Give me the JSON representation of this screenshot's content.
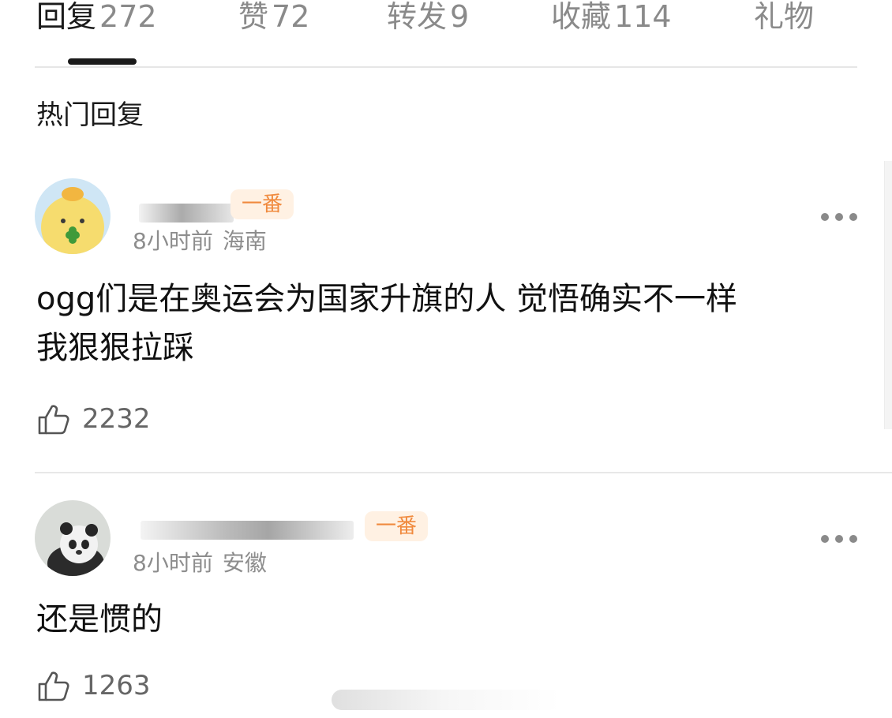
{
  "tabs": [
    {
      "label": "回复",
      "count": "272"
    },
    {
      "label": "赞",
      "count": "72"
    },
    {
      "label": "转发",
      "count": "9"
    },
    {
      "label": "收藏",
      "count": "114"
    },
    {
      "label": "礼物",
      "count": ""
    }
  ],
  "section_title": "热门回复",
  "comments": [
    {
      "badge": "一番",
      "time": "8小时前",
      "location": "海南",
      "text_line1": "ogg们是在奥运会为国家升旗的人 觉悟确实不一样",
      "text_line2": "我狠狠拉踩",
      "likes": "2232"
    },
    {
      "badge": "一番",
      "time": "8小时前",
      "location": "安徽",
      "text_line1": "还是惯的",
      "likes": "1263"
    }
  ],
  "colors": {
    "badge_text": "#f08a3e",
    "badge_bg": "#fff1e3",
    "active_tab": "#1a1a1a",
    "muted": "#8a8a8a"
  },
  "icons": [
    "thumbs-up-icon",
    "more-dots-icon"
  ]
}
